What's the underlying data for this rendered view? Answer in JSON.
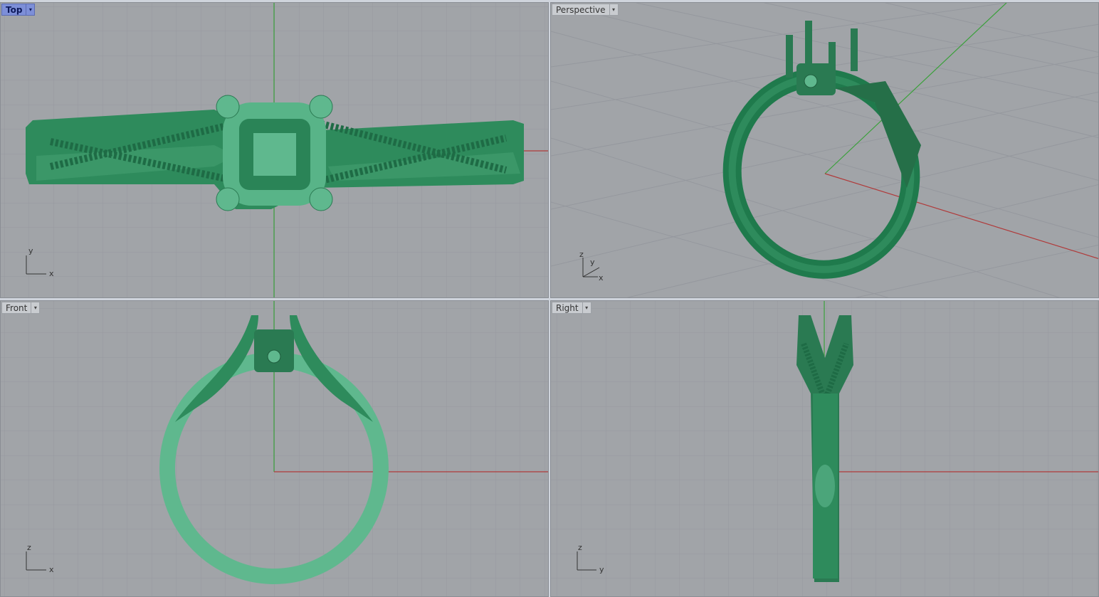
{
  "viewports": {
    "top": {
      "label": "Top",
      "axis_h": "x",
      "axis_v": "y"
    },
    "perspective": {
      "label": "Perspective",
      "axis_x": "x",
      "axis_y": "y",
      "axis_z": "z"
    },
    "front": {
      "label": "Front",
      "axis_h": "x",
      "axis_v": "z"
    },
    "right": {
      "label": "Right",
      "axis_h": "y",
      "axis_v": "z"
    }
  },
  "colors": {
    "viewport_bg": "#a1a4a8",
    "grid_minor": "#9498a0",
    "grid_major": "#898d95",
    "axis_x": "#b03a3a",
    "axis_y": "#3aa03a",
    "ring_light": "#5fb88e",
    "ring_dark": "#1f7a4c",
    "active_label": "#7d8fd8"
  },
  "icons": {
    "dropdown": "chevron-down-icon"
  }
}
